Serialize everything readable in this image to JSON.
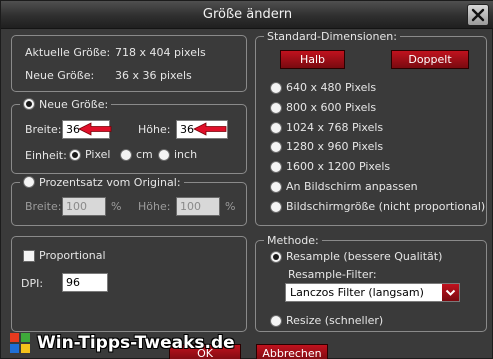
{
  "window": {
    "title": "Größe ändern"
  },
  "current": {
    "current_label": "Aktuelle Größe:",
    "current_value": "718  x  404  pixels",
    "new_label": "Neue Größe:",
    "new_value": "36  x  36  pixels"
  },
  "new_size": {
    "label": "Neue Größe:",
    "width_label": "Breite:",
    "width_value": "36",
    "height_label": "Höhe:",
    "height_value": "36",
    "unit_label": "Einheit:",
    "units": [
      "Pixel",
      "cm",
      "inch"
    ],
    "selected_unit": "Pixel"
  },
  "percent": {
    "label": "Prozentsatz vom Original:",
    "width_label": "Breite:",
    "width_value": "100",
    "height_label": "Höhe:",
    "height_value": "100",
    "unit": "%"
  },
  "proportional": {
    "checkbox_label": "Proportional",
    "dpi_label": "DPI:",
    "dpi_value": "96"
  },
  "standard": {
    "label": "Standard-Dimensionen:",
    "half_label": "Halb",
    "double_label": "Doppelt",
    "options": [
      "640 x 480 Pixels",
      "800 x 600 Pixels",
      "1024 x 768 Pixels",
      "1280 x 960 Pixels",
      "1600 x 1200 Pixels",
      "An Bildschirm anpassen",
      "Bildschirmgröße (nicht proportional)"
    ]
  },
  "method": {
    "label": "Methode:",
    "resample_label": "Resample (bessere Qualität)",
    "filter_label": "Resample-Filter:",
    "filter_value": "Lanczos Filter (langsam)",
    "resize_label": "Resize (schneller)"
  },
  "footer": {
    "ok_label": "OK",
    "cancel_label": "Abbrechen"
  },
  "watermark": {
    "text": "Win-Tipps-Tweaks.de"
  },
  "colors": {
    "accent_red": "#c0121e",
    "arrow_red": "#e0102a"
  }
}
